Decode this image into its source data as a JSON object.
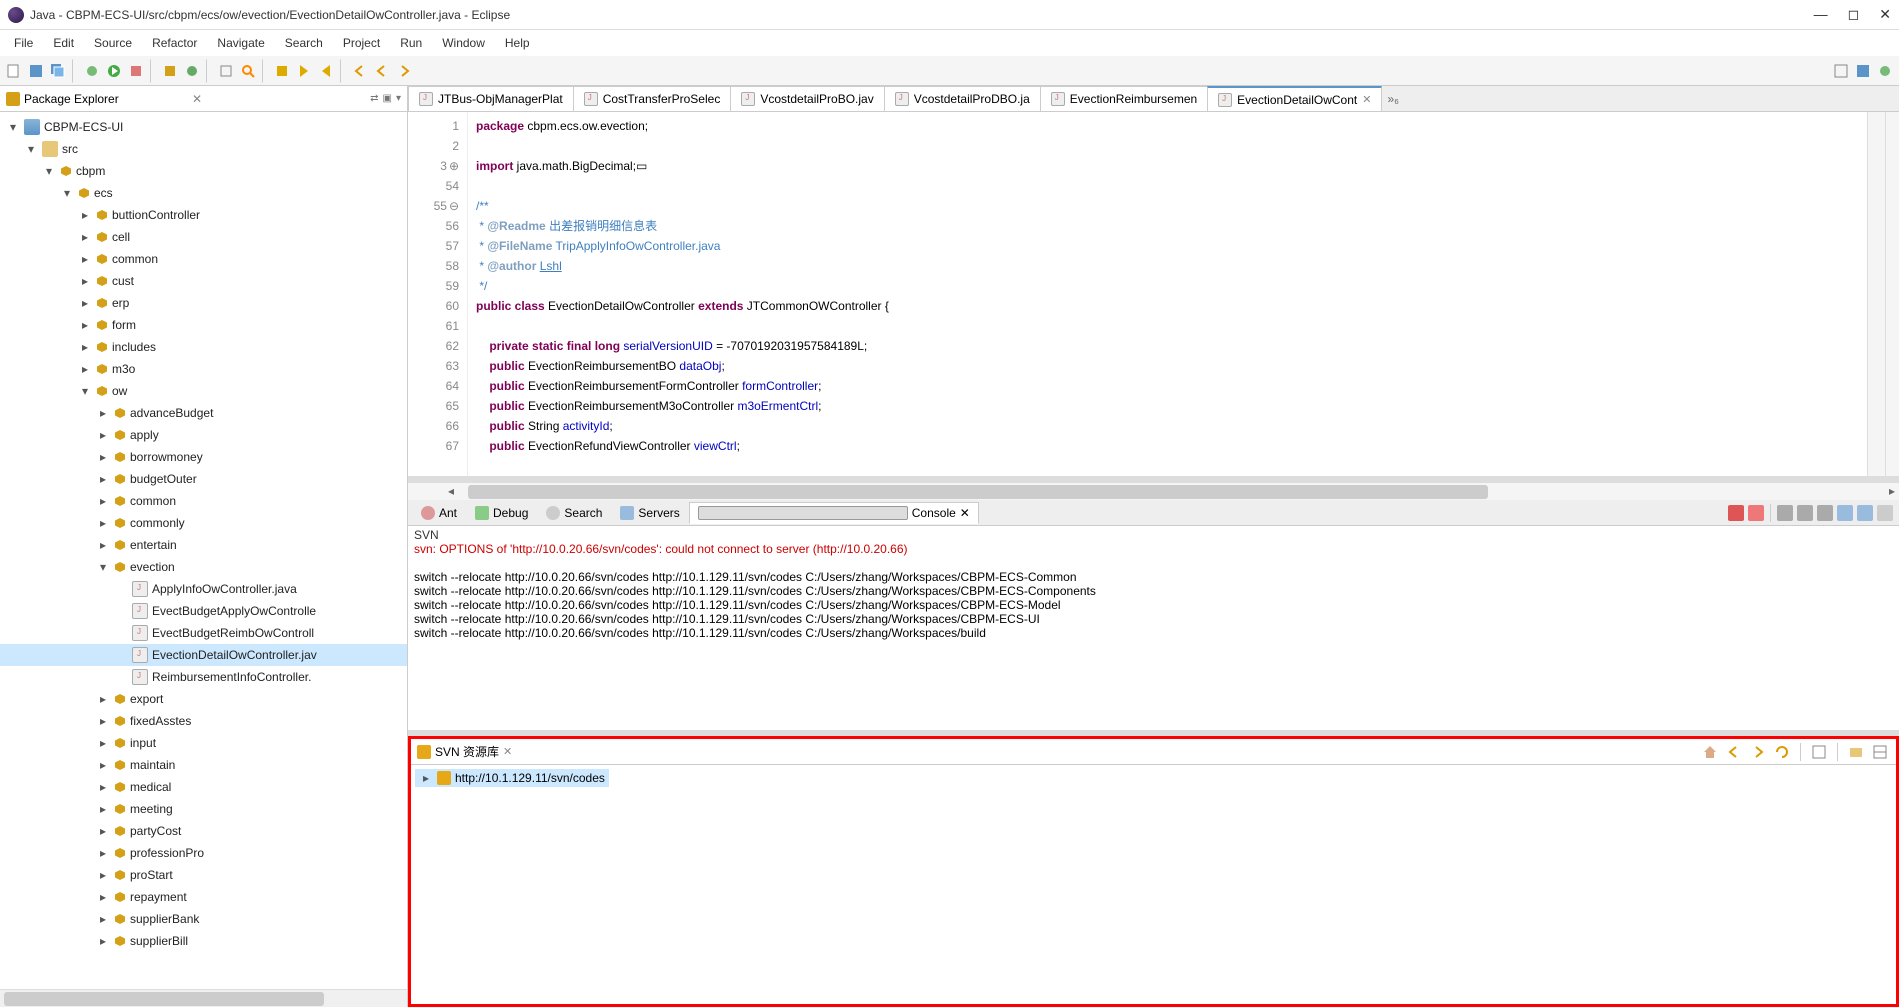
{
  "window": {
    "title": "Java - CBPM-ECS-UI/src/cbpm/ecs/ow/evection/EvectionDetailOwController.java - Eclipse"
  },
  "menu": [
    "File",
    "Edit",
    "Source",
    "Refactor",
    "Navigate",
    "Search",
    "Project",
    "Run",
    "Window",
    "Help"
  ],
  "package_explorer": {
    "title": "Package Explorer"
  },
  "tree": {
    "project": "CBPM-ECS-UI",
    "src": "src",
    "packages_top": [
      "cbpm",
      "ecs"
    ],
    "pkgs_lvl3": [
      "buttionController",
      "cell",
      "common",
      "cust",
      "erp",
      "form",
      "includes",
      "m3o",
      "ow"
    ],
    "ow_children": [
      "advanceBudget",
      "apply",
      "borrowmoney",
      "budgetOuter",
      "common",
      "commonly",
      "entertain",
      "evection"
    ],
    "evection_files": [
      "ApplyInfoOwController.java",
      "EvectBudgetApplyOwControlle",
      "EvectBudgetReimbOwControll",
      "EvectionDetailOwController.jav",
      "ReimbursementInfoController."
    ],
    "after_evection": [
      "export",
      "fixedAsstes",
      "input",
      "maintain",
      "medical",
      "meeting",
      "partyCost",
      "professionPro",
      "proStart",
      "repayment",
      "supplierBank",
      "supplierBill"
    ],
    "selected_file": "EvectionDetailOwController.jav"
  },
  "editor_tabs": [
    "JTBus-ObjManagerPlat",
    "CostTransferProSelec",
    "VcostdetailProBO.jav",
    "VcostdetailProDBO.ja",
    "EvectionReimbursemen",
    "EvectionDetailOwCont"
  ],
  "editor_tabs_more": "»₆",
  "editor": {
    "lines": [
      {
        "n": "1",
        "t": "package",
        "r": " cbpm.ecs.ow.evection;"
      },
      {
        "n": "2",
        "t": "",
        "r": ""
      },
      {
        "n": "3",
        "fold": "⊕",
        "t": "import",
        "r": " java.math.BigDecimal;▭"
      },
      {
        "n": "54",
        "t": "",
        "r": ""
      },
      {
        "n": "55",
        "fold": "⊖",
        "cm": "/**"
      },
      {
        "n": "56",
        "cm": " * ",
        "tag": "@Readme",
        "cmr": " 出差报销明细信息表"
      },
      {
        "n": "57",
        "cm": " * ",
        "tag": "@FileName",
        "cmr": " TripApplyInfoOwController.java"
      },
      {
        "n": "58",
        "cm": " * ",
        "tag": "@author",
        "cmr": " ",
        "u": "Lshl"
      },
      {
        "n": "59",
        "cm": " */"
      },
      {
        "n": "60",
        "t": "public class",
        "id": " EvectionDetailOwController ",
        "t2": "extends",
        "r2": " JTCommonOWController {"
      },
      {
        "n": "61",
        "t": "",
        "r": ""
      },
      {
        "n": "62",
        "pad": "    ",
        "t": "private static final long",
        "fld": " serialVersionUID",
        "r": " = -7070192031957584189L;"
      },
      {
        "n": "63",
        "pad": "    ",
        "t": "public",
        "r1": " EvectionReimbursementBO ",
        "fld": "dataObj",
        "r": ";"
      },
      {
        "n": "64",
        "pad": "    ",
        "t": "public",
        "r1": " EvectionReimbursementFormController ",
        "fld": "formController",
        "r": ";"
      },
      {
        "n": "65",
        "pad": "    ",
        "t": "public",
        "r1": " EvectionReimbursementM3oController ",
        "fld": "m3oErmentCtrl",
        "r": ";"
      },
      {
        "n": "66",
        "pad": "    ",
        "t": "public",
        "r1": " String ",
        "fld": "activityId",
        "r": ";"
      },
      {
        "n": "67",
        "pad": "    ",
        "t": "public",
        "r1": " EvectionRefundViewController ",
        "fld": "viewCtrl",
        "r": ";"
      }
    ]
  },
  "bottom_tabs": [
    "Ant",
    "Debug",
    "Search",
    "Servers",
    "Console"
  ],
  "console": {
    "title": "SVN",
    "err": "svn: OPTIONS of 'http://10.0.20.66/svn/codes': could not connect to server (http://10.0.20.66)",
    "lines": [
      "switch --relocate http://10.0.20.66/svn/codes http://10.1.129.11/svn/codes C:/Users/zhang/Workspaces/CBPM-ECS-Common",
      "switch --relocate http://10.0.20.66/svn/codes http://10.1.129.11/svn/codes C:/Users/zhang/Workspaces/CBPM-ECS-Components",
      "switch --relocate http://10.0.20.66/svn/codes http://10.1.129.11/svn/codes C:/Users/zhang/Workspaces/CBPM-ECS-Model",
      "switch --relocate http://10.0.20.66/svn/codes http://10.1.129.11/svn/codes C:/Users/zhang/Workspaces/CBPM-ECS-UI",
      "switch --relocate http://10.0.20.66/svn/codes http://10.1.129.11/svn/codes C:/Users/zhang/Workspaces/build"
    ]
  },
  "svn": {
    "title": "SVN 资源库",
    "repo": "http://10.1.129.11/svn/codes"
  },
  "chart_data": null
}
